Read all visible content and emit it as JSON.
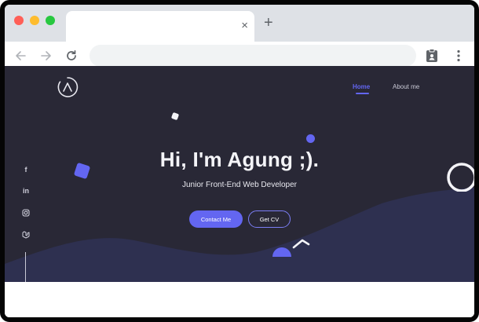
{
  "browser": {
    "tab_close_glyph": "×",
    "new_tab_glyph": "+",
    "address": ""
  },
  "site": {
    "nav": [
      {
        "label": "Home",
        "active": true
      },
      {
        "label": "About me",
        "active": false
      }
    ],
    "social": [
      {
        "icon": "facebook-icon",
        "glyph": "f"
      },
      {
        "icon": "linkedin-icon",
        "glyph": "in"
      },
      {
        "icon": "instagram-icon",
        "glyph": ""
      },
      {
        "icon": "laravel-icon",
        "glyph": ""
      }
    ],
    "hero": {
      "title": "Hi, I'm Agung ;).",
      "subtitle": "Junior Front-End Web Developer"
    },
    "buttons": {
      "contact": "Contact Me",
      "cv": "Get CV"
    }
  },
  "colors": {
    "background": "#292836",
    "wave": "#2e3050",
    "accent": "#6366f1",
    "text": "#f4f4f8"
  }
}
